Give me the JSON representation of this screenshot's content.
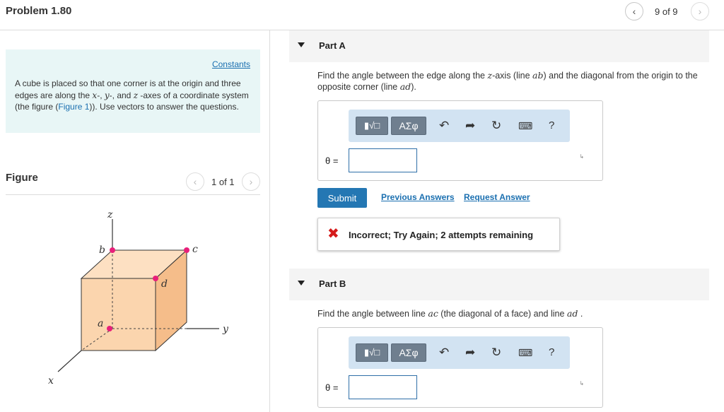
{
  "header": {
    "title": "Problem 1.80",
    "pager_text": "9 of 9",
    "prev_icon": "chevron-left-icon",
    "next_icon": "chevron-right-icon"
  },
  "left": {
    "constants_link": "Constants",
    "problem": {
      "t1": "A cube is placed so that one corner is at the origin and three edges are along the ",
      "x_var": "x",
      "t2": "-, ",
      "y_var": "y",
      "t3": "-, and ",
      "z_var": "z",
      "t4": " -axes of a coordinate system (the figure (",
      "figure_link": "Figure 1",
      "t5": ")). Use vectors to answer the questions."
    },
    "figure_label": "Figure",
    "figure_pager": "1 of 1",
    "figure_labels": {
      "z": "z",
      "y": "y",
      "x": "x",
      "a": "a",
      "b": "b",
      "c": "c",
      "d": "d"
    }
  },
  "part_a": {
    "label": "Part A",
    "q1": "Find the angle between the edge along the ",
    "q_z": "z",
    "q2": "-axis (line ",
    "q_ab": "ab",
    "q3": ") and the diagonal from the origin to the opposite corner (line ",
    "q_ad": "ad",
    "q4": ").",
    "symbol_button": "ΑΣφ",
    "help_button": "?",
    "theta_label": "θ =",
    "submit": "Submit",
    "previous_answers": "Previous Answers",
    "request_answer": "Request Answer",
    "feedback_message": "Incorrect; Try Again; 2 attempts remaining"
  },
  "part_b": {
    "label": "Part B",
    "q1": "Find the angle between line ",
    "q_ac": "ac",
    "q2": " (the diagonal of a face) and line ",
    "q_ad": "ad",
    "q3": " .",
    "symbol_button": "ΑΣφ",
    "help_button": "?",
    "theta_label": "θ ="
  },
  "colors": {
    "accent_blue": "#2477b3",
    "link_blue": "#1a6fb0",
    "constants_bg": "#e8f6f6",
    "cube_fill": "#fbd5ae",
    "cube_side": "#f5bd8a",
    "point_magenta": "#e8207a",
    "error_red": "#d51a1a",
    "toolbar_bg": "#d2e3f2"
  }
}
